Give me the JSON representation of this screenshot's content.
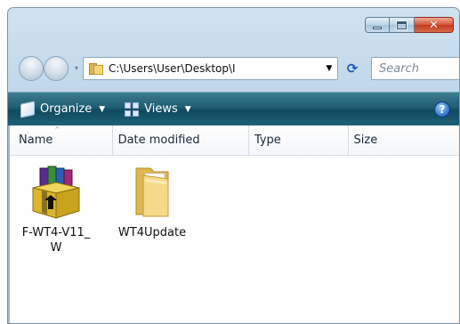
{
  "window": {
    "close_glyph": "✕"
  },
  "navigation": {
    "address": "C:\\Users\\User\\Desktop\\I",
    "address_dropdown_glyph": "▼",
    "refresh_glyph": "⟳",
    "search_placeholder": "Search",
    "history_dropdown_glyph": "▾"
  },
  "toolbar": {
    "organize_label": "Organize",
    "views_label": "Views",
    "caret_glyph": "▼",
    "help_glyph": "?"
  },
  "columns": {
    "name": "Name",
    "date_modified": "Date modified",
    "type": "Type",
    "size": "Size",
    "sort_glyph": "^"
  },
  "files": [
    {
      "label": "F-WT4-V11_\nW",
      "icon": "winrar-archive-icon"
    },
    {
      "label": "WT4Update",
      "icon": "folder-icon"
    }
  ],
  "colors": {
    "toolbar": "#1e5d72",
    "window_frame": "#b9d3e7",
    "close_button": "#c23a1f"
  }
}
